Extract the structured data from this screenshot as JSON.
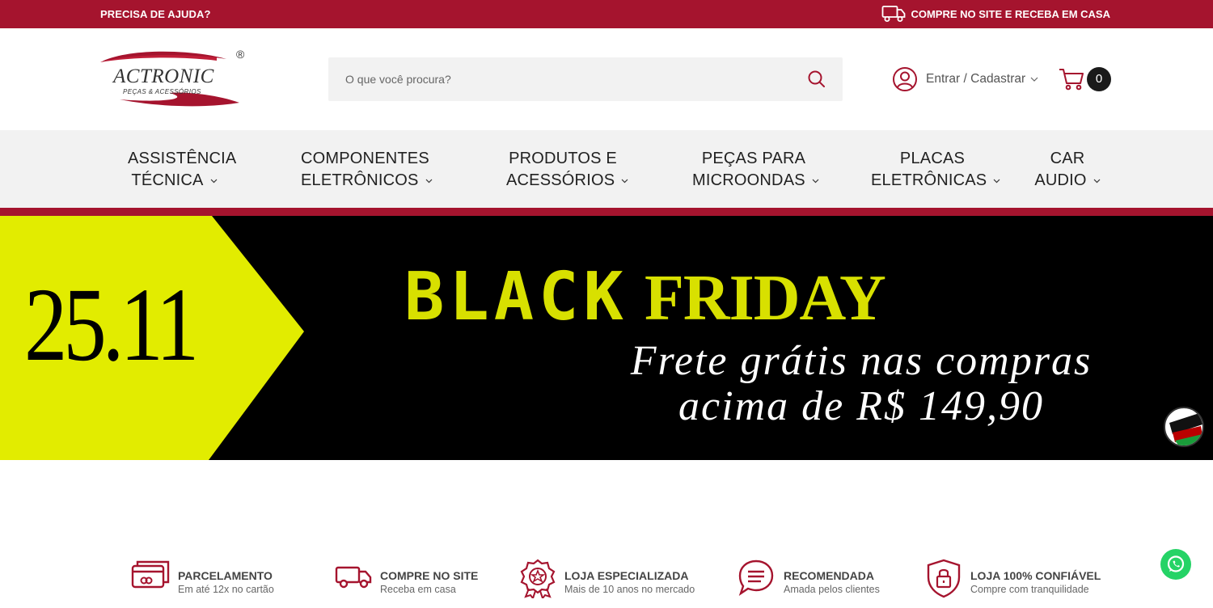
{
  "topbar": {
    "help": "PRECISA DE AJUDA?",
    "promo": "COMPRE NO SITE E RECEBA EM CASA"
  },
  "logo": {
    "name": "ACTRONIC",
    "tagline": "PEÇAS & ACESSÓRIOS",
    "registered": "®"
  },
  "search": {
    "placeholder": "O que você procura?"
  },
  "account": {
    "label": "Entrar / Cadastrar"
  },
  "cart": {
    "count": "0"
  },
  "nav": [
    {
      "line1": "ASSISTÊNCIA",
      "line2": "TÉCNICA"
    },
    {
      "line1": "COMPONENTES",
      "line2": "ELETRÔNICOS"
    },
    {
      "line1": "PRODUTOS E",
      "line2": "ACESSÓRIOS"
    },
    {
      "line1": "PEÇAS PARA",
      "line2": "MICROONDAS"
    },
    {
      "line1": "PLACAS",
      "line2": "ELETRÔNICAS"
    },
    {
      "line1": "CAR",
      "line2": "AUDIO"
    }
  ],
  "banner": {
    "date": "25.11",
    "black": "BLACK",
    "friday": "FRIDAY",
    "frete_line1": "Frete grátis nas compras",
    "frete_line2": "acima de R$ 149,90"
  },
  "features": [
    {
      "title": "PARCELAMENTO",
      "subtitle": "Em até 12x no cartão",
      "icon": "credit-card-icon"
    },
    {
      "title": "COMPRE NO SITE",
      "subtitle": "Receba em casa",
      "icon": "truck-icon"
    },
    {
      "title": "LOJA ESPECIALIZADA",
      "subtitle": "Mais de 10 anos no mercado",
      "icon": "award-icon"
    },
    {
      "title": "RECOMENDADA",
      "subtitle": "Amada pelos clientes",
      "icon": "chat-icon"
    },
    {
      "title": "LOJA 100% CONFIÁVEL",
      "subtitle": "Compre com tranquilidade",
      "icon": "shield-lock-icon"
    }
  ],
  "colors": {
    "brand": "#a5142e",
    "banner_yellow": "#d8e000",
    "nav_bg": "#f2f2f2"
  }
}
